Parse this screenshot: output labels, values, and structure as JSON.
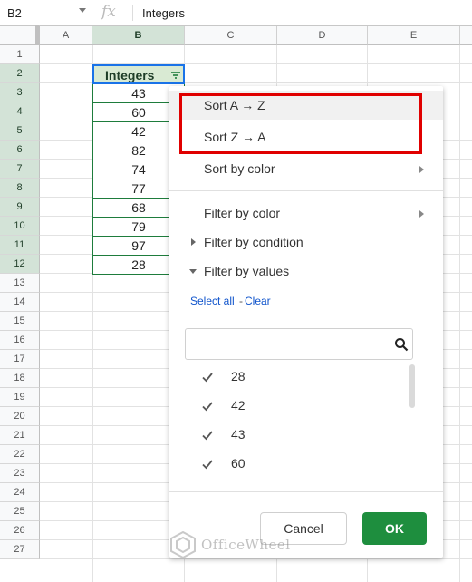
{
  "formula_bar": {
    "cell_ref": "B2",
    "fx_label": "fx",
    "value": "Integers"
  },
  "columns": [
    "A",
    "B",
    "C",
    "D",
    "E"
  ],
  "rows": [
    "1",
    "2",
    "3",
    "4",
    "5",
    "6",
    "7",
    "8",
    "9",
    "10",
    "11",
    "12",
    "13",
    "14",
    "15",
    "16",
    "17",
    "18",
    "19",
    "20",
    "21",
    "22",
    "23",
    "24",
    "25",
    "26",
    "27"
  ],
  "header_cell": "Integers",
  "cells": [
    "43",
    "60",
    "42",
    "82",
    "74",
    "77",
    "68",
    "79",
    "97",
    "28"
  ],
  "menu": {
    "sort_az": "Sort A → Z",
    "sort_za": "Sort Z → A",
    "sort_by_color": "Sort by color",
    "filter_by_color": "Filter by color",
    "filter_by_condition": "Filter by condition",
    "filter_by_values": "Filter by values",
    "select_all": "Select all",
    "separator": "-",
    "clear": "Clear",
    "values": [
      "28",
      "42",
      "43",
      "60"
    ],
    "cancel": "Cancel",
    "ok": "OK"
  },
  "watermark": "OfficeWheel",
  "colors": {
    "accent_green": "#1e8e3e",
    "selection_blue": "#1a73e8",
    "highlight_red": "#e00000",
    "header_fill": "#d9ead3"
  }
}
